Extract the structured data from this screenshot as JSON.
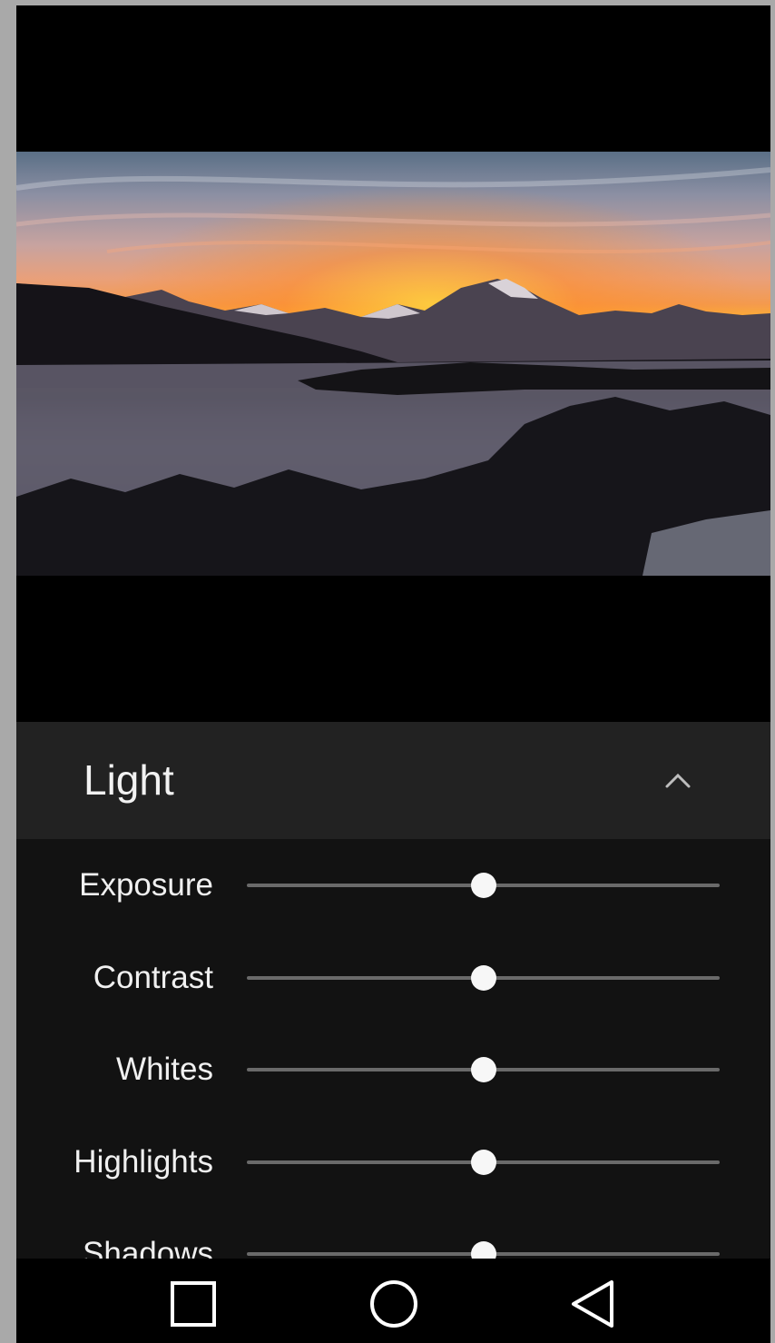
{
  "panel": {
    "title": "Light",
    "collapse_icon": "chevron-up-icon"
  },
  "sliders": [
    {
      "label": "Exposure",
      "value": 0.5
    },
    {
      "label": "Contrast",
      "value": 0.5
    },
    {
      "label": "Whites",
      "value": 0.5
    },
    {
      "label": "Highlights",
      "value": 0.5
    },
    {
      "label": "Shadows",
      "value": 0.5
    }
  ],
  "navbar": {
    "recents_icon": "square-recents-icon",
    "home_icon": "circle-home-icon",
    "back_icon": "triangle-back-icon"
  },
  "colors": {
    "panel_bg": "#121212",
    "header_bg": "#222222",
    "thumb": "#f7f7f7",
    "track": "#6a6a6a"
  }
}
